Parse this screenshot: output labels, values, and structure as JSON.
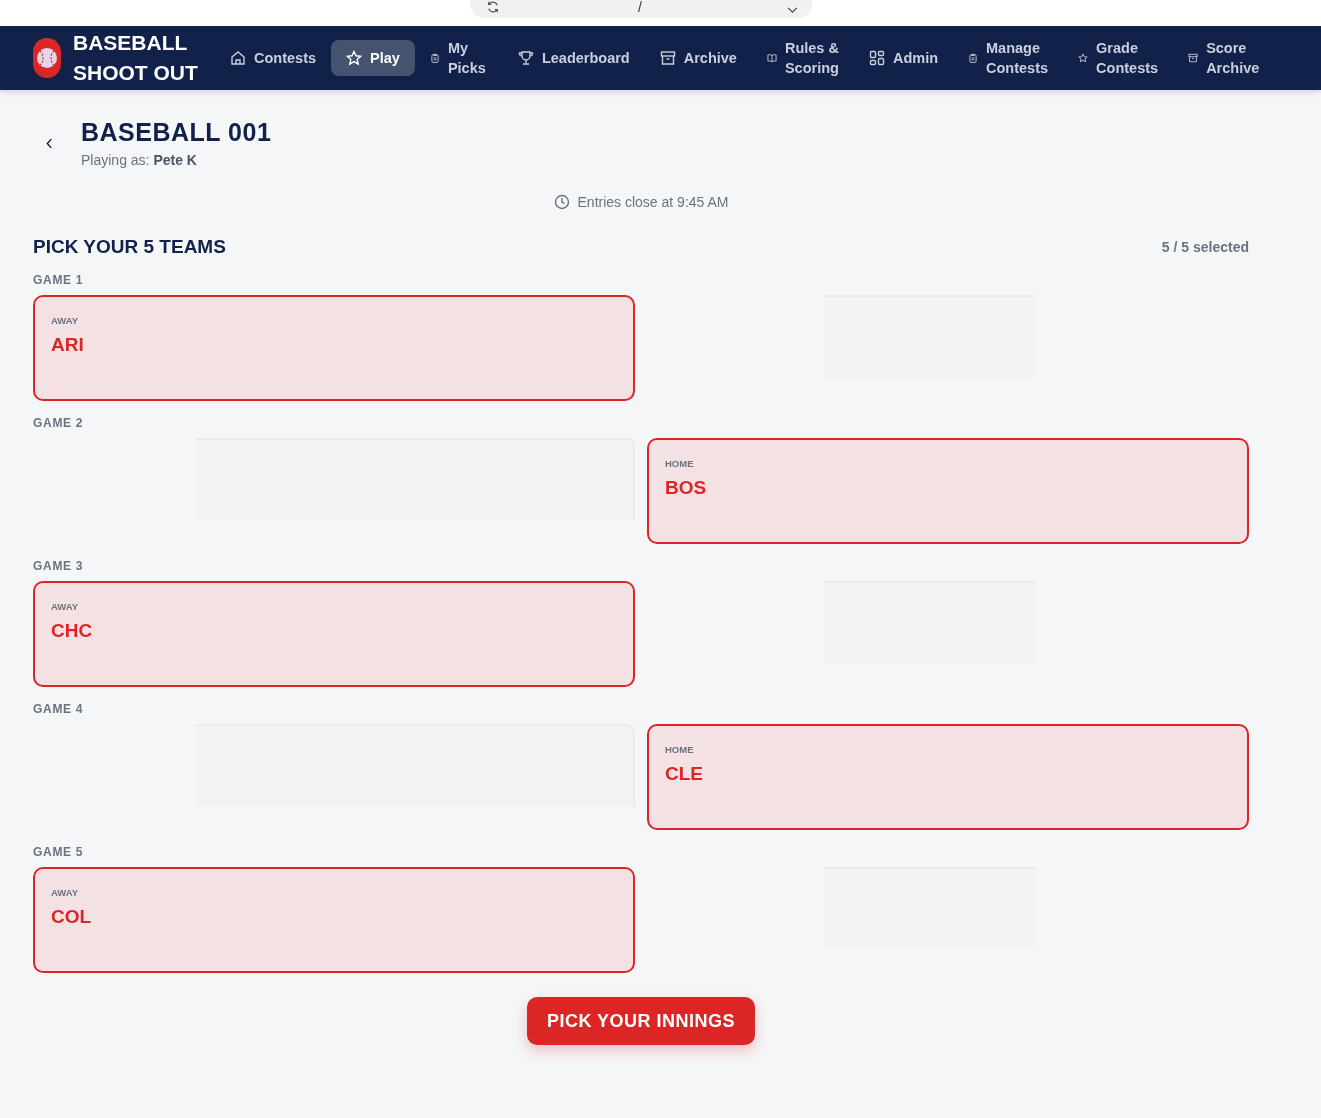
{
  "address_bar": {
    "text": "/"
  },
  "brand": {
    "line1": "BASEBALL",
    "line2": "SHOOT OUT"
  },
  "nav": [
    {
      "label": "Contests",
      "selected": false
    },
    {
      "label": "Play",
      "selected": true
    },
    {
      "label": "My Picks",
      "selected": false
    },
    {
      "label": "Leaderboard",
      "selected": false
    },
    {
      "label": "Archive",
      "selected": false
    },
    {
      "label": "Rules & Scoring",
      "selected": false
    },
    {
      "label": "Admin",
      "selected": false
    },
    {
      "label": "Manage Contests",
      "selected": false
    },
    {
      "label": "Grade Contests",
      "selected": false
    },
    {
      "label": "Score Archive",
      "selected": false
    }
  ],
  "contest": {
    "title": "BASEBALL 001",
    "playing_as_label": "Playing as:",
    "player": "Pete K"
  },
  "deadline": "Entries close at 9:45 AM",
  "section_title": "PICK YOUR 5 TEAMS",
  "selected_count": "5 / 5 selected",
  "games": [
    {
      "label": "GAME 1",
      "away": {
        "side": "AWAY",
        "team": "ARI",
        "selected": true
      },
      "home": {
        "selected": false
      }
    },
    {
      "label": "GAME 2",
      "away": {
        "selected": false
      },
      "home": {
        "side": "HOME",
        "team": "BOS",
        "selected": true
      }
    },
    {
      "label": "GAME 3",
      "away": {
        "side": "AWAY",
        "team": "CHC",
        "selected": true
      },
      "home": {
        "selected": false
      }
    },
    {
      "label": "GAME 4",
      "away": {
        "selected": false
      },
      "home": {
        "side": "HOME",
        "team": "CLE",
        "selected": true
      }
    },
    {
      "label": "GAME 5",
      "away": {
        "side": "AWAY",
        "team": "COL",
        "selected": true
      },
      "home": {
        "selected": false
      }
    }
  ],
  "submit_button": "PICK YOUR INNINGS"
}
